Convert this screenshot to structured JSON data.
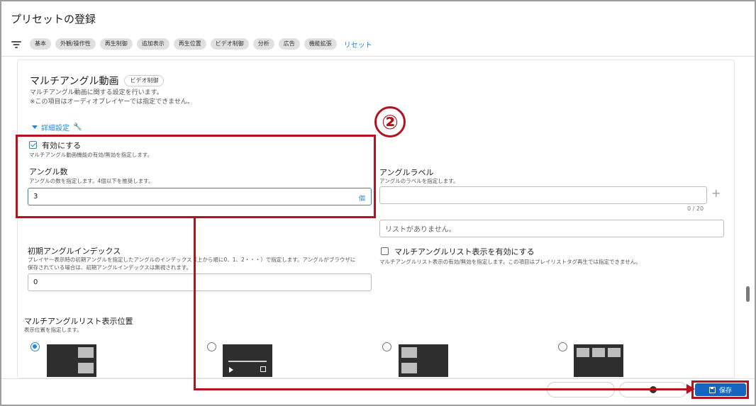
{
  "page": {
    "title": "プリセットの登録"
  },
  "filters": {
    "chips": [
      "基本",
      "外観/操作性",
      "再生制御",
      "追加表示",
      "再生位置",
      "ビデオ制御",
      "分析",
      "広告",
      "機能拡張"
    ],
    "reset_label": "リセット"
  },
  "section": {
    "title": "マルチアングル動画",
    "chip": "ビデオ制御",
    "desc1": "マルチアングル動画に関する設定を行います。",
    "desc2": "※この項目はオーディオプレイヤーでは指定できません。",
    "detail_toggle": "詳細設定"
  },
  "enable": {
    "label": "有効にする",
    "help": "マルチアングル動画機能の有効/無効を指定します。",
    "checked": true
  },
  "angle_count": {
    "label": "アングル数",
    "help": "アングルの数を指定します。4個以下を推奨します。",
    "value": "3",
    "suffix": "個"
  },
  "angle_label": {
    "label": "アングルラベル",
    "help": "アングルのラベルを指定します。",
    "value": "",
    "counter": "0 / 20",
    "empty_list": "リストがありません。"
  },
  "initial_index": {
    "label": "初期アングルインデックス",
    "help1": "プレイヤー表示時の初期アングルを指定したアングルのインデックス（上から順に0、1、2・・・）で指定します。アングルがブラウザに",
    "help2": "保存されている場合は、初期アングルインデックスは無視されます。",
    "value": "0"
  },
  "list_display": {
    "label": "マルチアングルリスト表示を有効にする",
    "help": "マルチアングルリスト表示の有効/無効を指定します。この項目はプレイリストタグ再生では指定できません。",
    "checked": false
  },
  "list_position": {
    "label": "マルチアングルリスト表示位置",
    "help": "表示位置を指定します。",
    "options": [
      "right",
      "bottom",
      "left",
      "top"
    ],
    "selected": "right"
  },
  "footer": {
    "save_label": "保存"
  },
  "annotation": {
    "step_number": "②",
    "color": "#b3121f"
  },
  "colors": {
    "accent": "#1e88e5",
    "save_button": "#1565c0"
  }
}
